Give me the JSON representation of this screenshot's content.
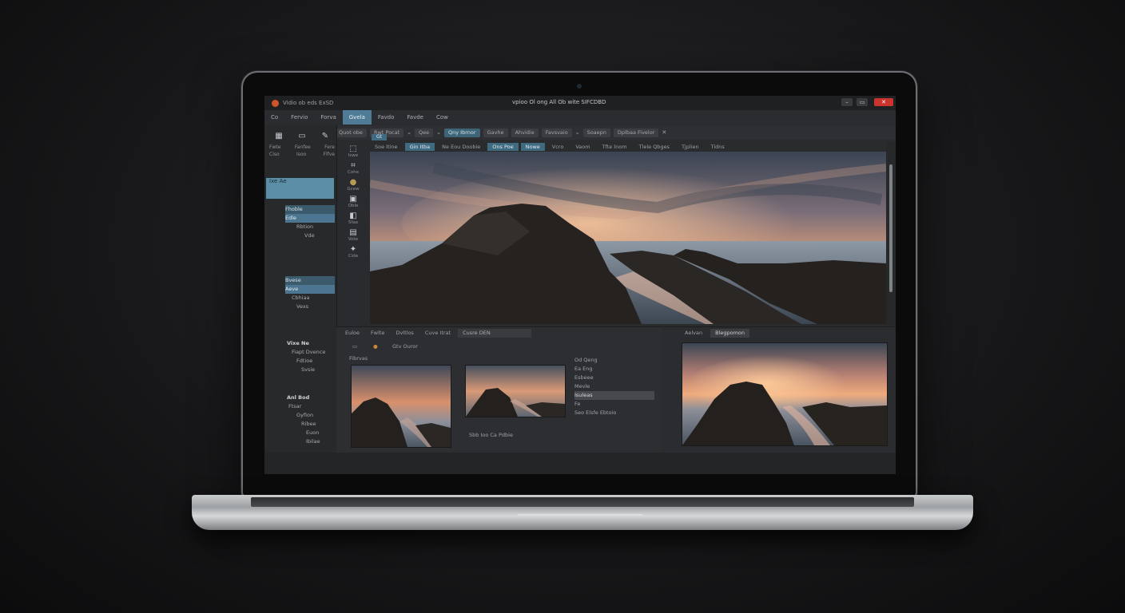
{
  "window": {
    "app_name": "Vidio ob eds ExSD",
    "doc_title": "vpioo Ol ong All Ob wite SIFCDBD",
    "minimize": "–",
    "maximize": "▭",
    "close": "✕"
  },
  "menu": [
    "Co",
    "Fervio",
    "Forva",
    "Gvela",
    "Favdo",
    "Favde",
    "Cow"
  ],
  "menu_active_index": 3,
  "toolbar": {
    "f1": "Quot obe",
    "f2": "Rwt Pocat",
    "f3": "Qee",
    "f4": "Qny Ibrnor",
    "f5": "Gavhe",
    "f6": "Ahvidie",
    "f7": "Favsvaio",
    "f8": "Soaepn",
    "f9": "Dplbaa Fivelor",
    "close": "✕"
  },
  "left_panel": {
    "icon_labels": [
      "Fwte",
      "Fanfee",
      "Fere"
    ],
    "labels_row": [
      "Ciso",
      "Isoo",
      "Flfve"
    ],
    "selection_label": "Ixe Ae",
    "tree1": [
      "Fhoble",
      "Edle",
      "Rbtion",
      "Vde"
    ],
    "tree2_head": "Bvese",
    "tree2": [
      "Aeve",
      "Cbhiaa",
      "Vexs"
    ],
    "tree3_head": "Vixe Ne",
    "tree3": [
      "Fiapt Dvence",
      "Fdtioe",
      "Svsie"
    ],
    "tree4_head": "Anl Bod",
    "tree4": [
      "Ftsar",
      "Gyfion",
      "Ribee",
      "Euon",
      "Ibilae"
    ]
  },
  "tools": [
    "Iswe",
    "Cohe",
    "Gcew",
    "Oble",
    "Sfae",
    "Vote",
    "Clde"
  ],
  "tabs": {
    "top_tab": "Gt",
    "items": [
      "Soe Itine",
      "Gin Itba",
      "Ne Eou Doobie",
      "Ons Poe",
      "Nowe",
      "Vcro",
      "Vaom",
      "Tfte lnom",
      "Tlele Qbges",
      "Tjplien",
      "Tidns"
    ],
    "active": [
      1,
      3,
      4
    ]
  },
  "bottom_left": {
    "tabs": [
      "Euloe",
      "Fwlte",
      "Dvltlos",
      "Cuve Itrat"
    ],
    "select": "Cusre DEN",
    "row1": "Gtv Ouror",
    "row2": "Fibrvas",
    "footer": "Sbb Ioo Ca Pdbie",
    "props": [
      "Od Qeng",
      "Ea Eng",
      "Esbeee",
      "Mevle",
      "Isuleas",
      "Fe",
      "Seo Elsfe Ebtoio"
    ],
    "prop_highlight": 4
  },
  "bottom_right": {
    "tabs": [
      "Aelvan",
      "Blegpomon"
    ]
  },
  "colors": {
    "accent": "#4f7b96",
    "close": "#c9352d",
    "logo": "#d0542b"
  }
}
